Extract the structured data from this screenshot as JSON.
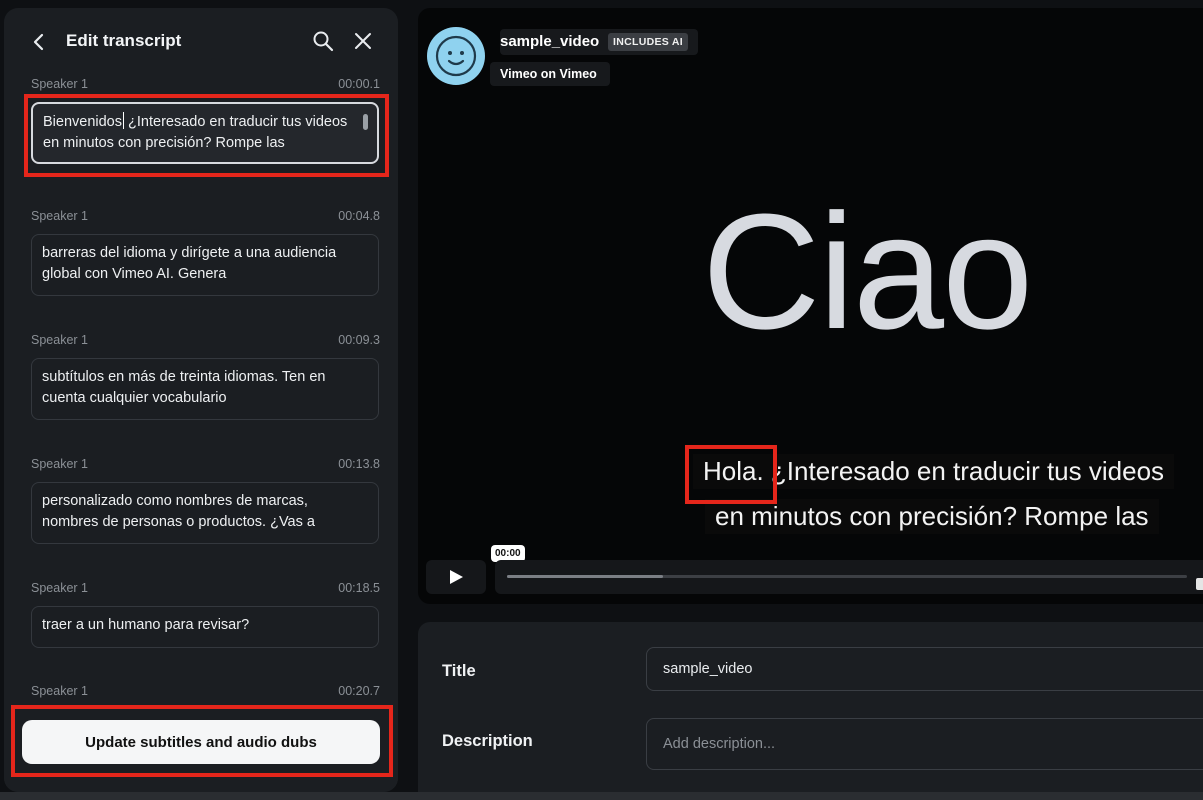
{
  "transcript_panel": {
    "title": "Edit transcript",
    "segments": [
      {
        "speaker": "Speaker 1",
        "time": "00:00.1",
        "text_before_caret": "Bienvenidos",
        "text_after_caret": " ¿Interesado en traducir tus videos",
        "text_overflow": "en minutos con precisión? Rompe las"
      },
      {
        "speaker": "Speaker 1",
        "time": "00:04.8",
        "text": "barreras del idioma y dirígete a una audiencia global con Vimeo AI. Genera"
      },
      {
        "speaker": "Speaker 1",
        "time": "00:09.3",
        "text": "subtítulos en más de treinta idiomas. Ten en cuenta cualquier vocabulario"
      },
      {
        "speaker": "Speaker 1",
        "time": "00:13.8",
        "text": "personalizado como nombres de marcas, nombres de personas o productos. ¿Vas a"
      },
      {
        "speaker": "Speaker 1",
        "time": "00:18.5",
        "text": "traer a un humano para revisar?"
      },
      {
        "speaker": "Speaker 1",
        "time": "00:20.7"
      }
    ],
    "update_button_label": "Update subtitles and audio dubs"
  },
  "video": {
    "name": "sample_video",
    "badge": "INCLUDES AI",
    "owner": "Vimeo on Vimeo",
    "display_word": "Ciao",
    "caption_first_word": "Hola.",
    "caption_line1_rest": " ¿Interesado en traducir tus videos",
    "caption_line2": "en minutos con precisión? Rompe las",
    "current_time": "00:00",
    "progress_fraction": 0.23
  },
  "details": {
    "title_label": "Title",
    "title_value": "sample_video",
    "description_label": "Description",
    "description_placeholder": "Add description..."
  },
  "colors": {
    "highlight": "#e5261b",
    "avatar": "#8fd2ef",
    "panel_bg": "#1b1e22"
  }
}
